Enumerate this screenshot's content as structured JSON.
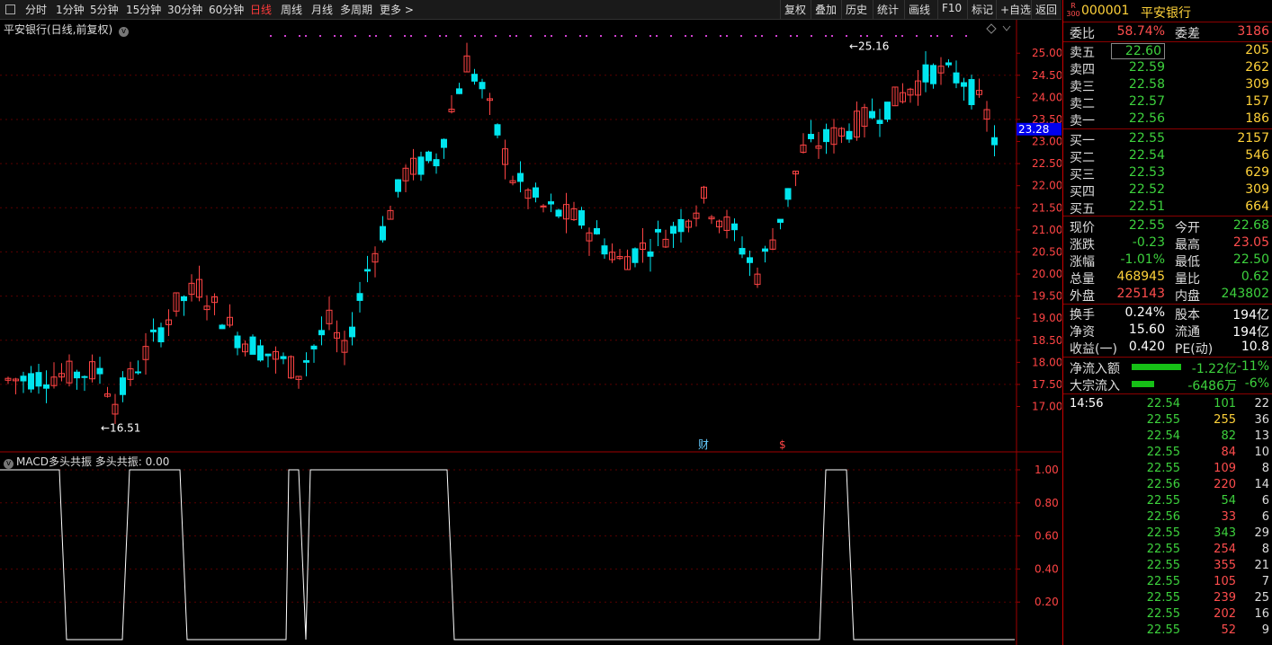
{
  "toolbar": {
    "periods": [
      "分时",
      "1分钟",
      "5分钟",
      "15分钟",
      "30分钟",
      "60分钟",
      "日线",
      "周线",
      "月线",
      "多周期",
      "更多 >"
    ],
    "active_period": "日线",
    "right_tools": [
      "复权",
      "叠加",
      "历史",
      "统计",
      "画线",
      "F10",
      "标记",
      "+自选",
      "返回"
    ]
  },
  "chart": {
    "title": "平安银行(日线,前复权)",
    "current_price_tag": "23.28",
    "high_marker": "25.16",
    "low_marker": "16.51",
    "price_axis": [
      "25.00",
      "24.50",
      "24.00",
      "23.50",
      "23.00",
      "22.50",
      "22.00",
      "21.50",
      "21.00",
      "20.50",
      "20.00",
      "19.50",
      "19.00",
      "18.50",
      "18.00",
      "17.50",
      "17.00"
    ],
    "event_markers": [
      "财",
      "$"
    ],
    "colors": {
      "up": "#ff4444",
      "down": "#00e5ee",
      "axis": "#ff4444",
      "grid": "#5a0000",
      "current": "#0000ee"
    }
  },
  "indicator": {
    "title": "MACD多头共振 多头共振: 0.00",
    "axis": [
      "1.00",
      "0.80",
      "0.60",
      "0.40",
      "0.20"
    ]
  },
  "quote": {
    "code": "000001",
    "name": "平安银行",
    "badge_top": "R",
    "badge_bottom": "300",
    "weibi_label": "委比",
    "weibi": "58.74%",
    "weicha_label": "委差",
    "weicha": "3186",
    "asks": [
      {
        "label": "卖五",
        "price": "22.60",
        "vol": "205"
      },
      {
        "label": "卖四",
        "price": "22.59",
        "vol": "262"
      },
      {
        "label": "卖三",
        "price": "22.58",
        "vol": "309"
      },
      {
        "label": "卖二",
        "price": "22.57",
        "vol": "157"
      },
      {
        "label": "卖一",
        "price": "22.56",
        "vol": "186"
      }
    ],
    "bids": [
      {
        "label": "买一",
        "price": "22.55",
        "vol": "2157"
      },
      {
        "label": "买二",
        "price": "22.54",
        "vol": "546"
      },
      {
        "label": "买三",
        "price": "22.53",
        "vol": "629"
      },
      {
        "label": "买四",
        "price": "22.52",
        "vol": "309"
      },
      {
        "label": "买五",
        "price": "22.51",
        "vol": "664"
      }
    ],
    "stats": [
      {
        "l1": "现价",
        "v1": "22.55",
        "c1": "green",
        "l2": "今开",
        "v2": "22.68",
        "c2": "green"
      },
      {
        "l1": "涨跌",
        "v1": "-0.23",
        "c1": "green",
        "l2": "最高",
        "v2": "23.05",
        "c2": "red"
      },
      {
        "l1": "涨幅",
        "v1": "-1.01%",
        "c1": "green",
        "l2": "最低",
        "v2": "22.50",
        "c2": "green"
      },
      {
        "l1": "总量",
        "v1": "468945",
        "c1": "yellow",
        "l2": "量比",
        "v2": "0.62",
        "c2": "green"
      },
      {
        "l1": "外盘",
        "v1": "225143",
        "c1": "red",
        "l2": "内盘",
        "v2": "243802",
        "c2": "green"
      }
    ],
    "fund": [
      {
        "l1": "换手",
        "v1": "0.24%",
        "l2": "股本",
        "v2": "194亿"
      },
      {
        "l1": "净资",
        "v1": "15.60",
        "l2": "流通",
        "v2": "194亿"
      },
      {
        "l1": "收益(一)",
        "v1": "0.420",
        "l2": "PE(动)",
        "v2": "10.8"
      }
    ],
    "flow": [
      {
        "label": "净流入额",
        "value": "-1.22亿",
        "pct": "-11%",
        "bar": 0.55
      },
      {
        "label": "大宗流入",
        "value": "-6486万",
        "pct": "-6%",
        "bar": 0.25
      }
    ],
    "ticks": [
      {
        "time": "14:56",
        "price": "22.54",
        "vol": "101",
        "n": "22",
        "pc": "green",
        "vc": "green"
      },
      {
        "time": "",
        "price": "22.55",
        "vol": "255",
        "n": "36",
        "pc": "green",
        "vc": "yellow"
      },
      {
        "time": "",
        "price": "22.54",
        "vol": "82",
        "n": "13",
        "pc": "green",
        "vc": "green"
      },
      {
        "time": "",
        "price": "22.55",
        "vol": "84",
        "n": "10",
        "pc": "green",
        "vc": "red"
      },
      {
        "time": "",
        "price": "22.55",
        "vol": "109",
        "n": "8",
        "pc": "green",
        "vc": "red"
      },
      {
        "time": "",
        "price": "22.56",
        "vol": "220",
        "n": "14",
        "pc": "green",
        "vc": "red"
      },
      {
        "time": "",
        "price": "22.55",
        "vol": "54",
        "n": "6",
        "pc": "green",
        "vc": "green"
      },
      {
        "time": "",
        "price": "22.56",
        "vol": "33",
        "n": "6",
        "pc": "green",
        "vc": "red"
      },
      {
        "time": "",
        "price": "22.55",
        "vol": "343",
        "n": "29",
        "pc": "green",
        "vc": "green"
      },
      {
        "time": "",
        "price": "22.55",
        "vol": "254",
        "n": "8",
        "pc": "green",
        "vc": "red"
      },
      {
        "time": "",
        "price": "22.55",
        "vol": "355",
        "n": "21",
        "pc": "green",
        "vc": "red"
      },
      {
        "time": "",
        "price": "22.55",
        "vol": "105",
        "n": "7",
        "pc": "green",
        "vc": "red"
      },
      {
        "time": "",
        "price": "22.55",
        "vol": "239",
        "n": "25",
        "pc": "green",
        "vc": "red"
      },
      {
        "time": "",
        "price": "22.55",
        "vol": "202",
        "n": "16",
        "pc": "green",
        "vc": "red"
      },
      {
        "time": "",
        "price": "22.55",
        "vol": "52",
        "n": "9",
        "pc": "green",
        "vc": "red"
      }
    ]
  }
}
